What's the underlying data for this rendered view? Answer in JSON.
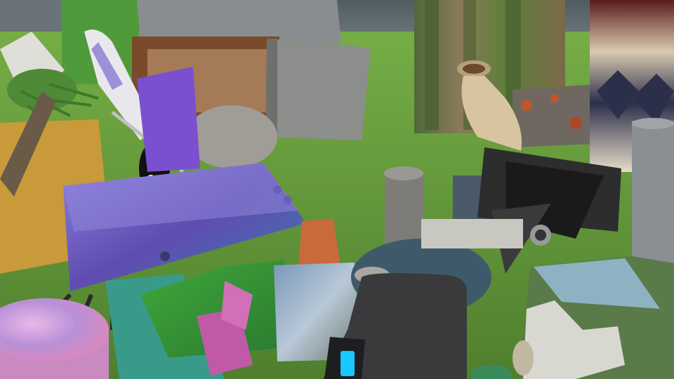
{
  "scene": {
    "kind": "3d-render",
    "description_visible_text": "",
    "palette": {
      "sky": "#5f6b72",
      "grass": "#5b8d3a",
      "grass_light": "#79b04a",
      "bark": "#6b5a3c",
      "purple": "#7a5fc9",
      "camera_dark": "#2d2d2d",
      "screen_cyan": "#18c8ff"
    }
  }
}
